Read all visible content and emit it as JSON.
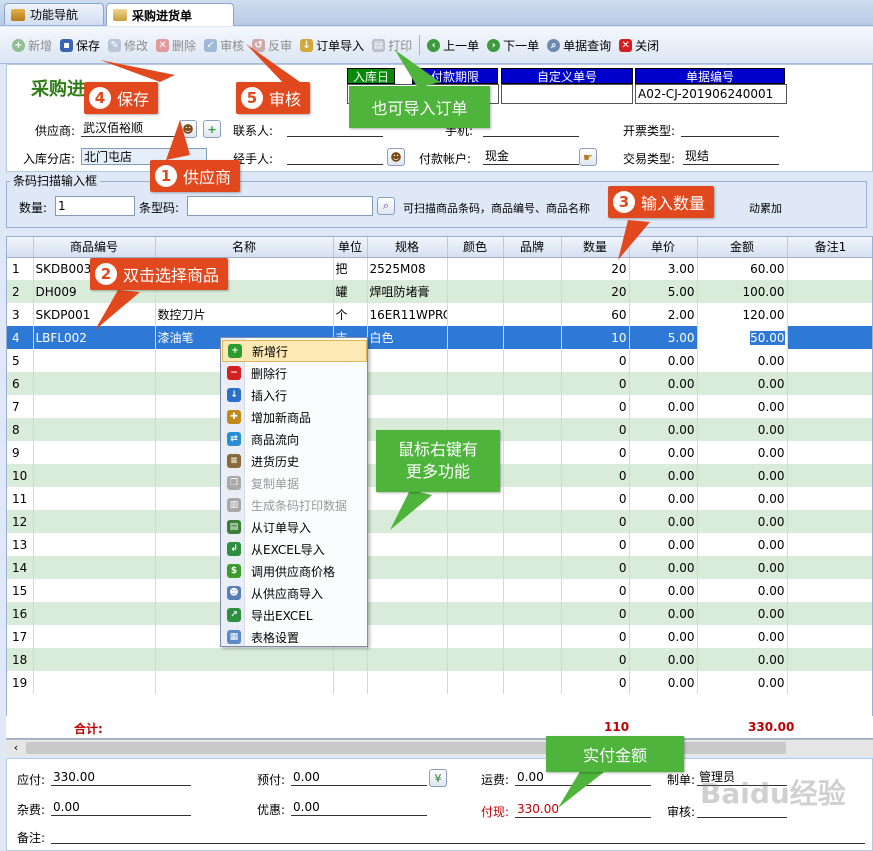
{
  "tabs": [
    {
      "label": "功能导航"
    },
    {
      "label": "采购进货单"
    }
  ],
  "toolbar": {
    "add": "新增",
    "save": "保存",
    "edit": "修改",
    "delete": "删除",
    "audit": "审核",
    "unaudit": "反审",
    "import_order": "订单导入",
    "print": "打印",
    "prev": "上一单",
    "next": "下一单",
    "query": "单据查询",
    "close": "关闭"
  },
  "header": {
    "title": "采购进",
    "col_store": "入库日",
    "col_payterm": "付款期限",
    "col_custom": "自定义单号",
    "col_billno": "单据编号",
    "billno_value": "A02-CJ-201906240001",
    "supplier_label": "供应商:",
    "supplier_value": "武汉佰裕顺",
    "contact_label": "联系人:",
    "phone_label": "手机:",
    "invoice_label": "开票类型:",
    "branch_label": "入库分店:",
    "branch_value": "北门屯店",
    "handler_label": "经手人:",
    "account_label": "付款帐户:",
    "account_value": "现金",
    "trade_label": "交易类型:",
    "trade_value": "现结"
  },
  "barcode": {
    "legend": "条码扫描输入框",
    "qty_label": "数量:",
    "qty_value": "1",
    "code_label": "条型码:",
    "hint": "可扫描商品条码，商品编号、商品名称",
    "hint_tail": "动累加"
  },
  "grid": {
    "columns": [
      "",
      "商品编号",
      "名称",
      "单位",
      "规格",
      "颜色",
      "品牌",
      "数量",
      "单价",
      "金额",
      "备注1"
    ],
    "rows": [
      {
        "no": "1",
        "code": "SKDB003",
        "name": "",
        "unit": "把",
        "spec": "2525M08",
        "qty": "20",
        "price": "3.00",
        "amount": "60.00"
      },
      {
        "no": "2",
        "code": "DH009",
        "name": "",
        "unit": "罐",
        "spec": "焊咀防堵膏",
        "qty": "20",
        "price": "5.00",
        "amount": "100.00"
      },
      {
        "no": "3",
        "code": "SKDP001",
        "name": "数控刀片",
        "unit": "个",
        "spec": "16ER11WPRC",
        "qty": "60",
        "price": "2.00",
        "amount": "120.00"
      },
      {
        "no": "4",
        "code": "LBFL002",
        "name": "漆油笔",
        "unit": "支",
        "spec": "白色",
        "qty": "10",
        "price": "5.00",
        "amount": "50.00"
      },
      {
        "no": "5",
        "code": "",
        "name": "",
        "unit": "",
        "spec": "",
        "qty": "0",
        "price": "0.00",
        "amount": "0.00"
      },
      {
        "no": "6",
        "code": "",
        "name": "",
        "unit": "",
        "spec": "",
        "qty": "0",
        "price": "0.00",
        "amount": "0.00"
      },
      {
        "no": "7",
        "code": "",
        "name": "",
        "unit": "",
        "spec": "",
        "qty": "0",
        "price": "0.00",
        "amount": "0.00"
      },
      {
        "no": "8",
        "code": "",
        "name": "",
        "unit": "",
        "spec": "",
        "qty": "0",
        "price": "0.00",
        "amount": "0.00"
      },
      {
        "no": "9",
        "code": "",
        "name": "",
        "unit": "",
        "spec": "",
        "qty": "0",
        "price": "0.00",
        "amount": "0.00"
      },
      {
        "no": "10",
        "code": "",
        "name": "",
        "unit": "",
        "spec": "",
        "qty": "0",
        "price": "0.00",
        "amount": "0.00"
      },
      {
        "no": "11",
        "code": "",
        "name": "",
        "unit": "",
        "spec": "",
        "qty": "0",
        "price": "0.00",
        "amount": "0.00"
      },
      {
        "no": "12",
        "code": "",
        "name": "",
        "unit": "",
        "spec": "",
        "qty": "0",
        "price": "0.00",
        "amount": "0.00"
      },
      {
        "no": "13",
        "code": "",
        "name": "",
        "unit": "",
        "spec": "",
        "qty": "0",
        "price": "0.00",
        "amount": "0.00"
      },
      {
        "no": "14",
        "code": "",
        "name": "",
        "unit": "",
        "spec": "",
        "qty": "0",
        "price": "0.00",
        "amount": "0.00"
      },
      {
        "no": "15",
        "code": "",
        "name": "",
        "unit": "",
        "spec": "",
        "qty": "0",
        "price": "0.00",
        "amount": "0.00"
      },
      {
        "no": "16",
        "code": "",
        "name": "",
        "unit": "",
        "spec": "",
        "qty": "0",
        "price": "0.00",
        "amount": "0.00"
      },
      {
        "no": "17",
        "code": "",
        "name": "",
        "unit": "",
        "spec": "",
        "qty": "0",
        "price": "0.00",
        "amount": "0.00"
      },
      {
        "no": "18",
        "code": "",
        "name": "",
        "unit": "",
        "spec": "",
        "qty": "0",
        "price": "0.00",
        "amount": "0.00"
      },
      {
        "no": "19",
        "code": "",
        "name": "",
        "unit": "",
        "spec": "",
        "qty": "0",
        "price": "0.00",
        "amount": "0.00"
      }
    ],
    "total_label": "合计:",
    "total_qty": "110",
    "total_amount": "330.00"
  },
  "context_menu": [
    {
      "label": "新增行",
      "icon": "plus-circle-icon",
      "color": "#2e9b2e",
      "glyph": "+",
      "disabled": false
    },
    {
      "label": "删除行",
      "icon": "minus-circle-icon",
      "color": "#d42020",
      "glyph": "−",
      "disabled": false
    },
    {
      "label": "插入行",
      "icon": "insert-row-icon",
      "color": "#2a6fc9",
      "glyph": "↓",
      "disabled": false
    },
    {
      "label": "增加新商品",
      "icon": "new-product-icon",
      "color": "#c08a18",
      "glyph": "✚",
      "disabled": false
    },
    {
      "label": "商品流向",
      "icon": "flow-icon",
      "color": "#2a8fd0",
      "glyph": "⇄",
      "disabled": false
    },
    {
      "label": "进货历史",
      "icon": "history-icon",
      "color": "#8a6a3a",
      "glyph": "≡",
      "disabled": false
    },
    {
      "label": "复制单据",
      "icon": "copy-icon",
      "color": "#a8a8a8",
      "glyph": "❐",
      "disabled": true
    },
    {
      "label": "生成条码打印数据",
      "icon": "barcode-icon",
      "color": "#a8a8a8",
      "glyph": "▥",
      "disabled": true
    },
    {
      "label": "从订单导入",
      "icon": "order-import-icon",
      "color": "#3a7f3a",
      "glyph": "▤",
      "disabled": false
    },
    {
      "label": "从EXCEL导入",
      "icon": "excel-import-icon",
      "color": "#2f8f40",
      "glyph": "↲",
      "disabled": false
    },
    {
      "label": "调用供应商价格",
      "icon": "price-icon",
      "color": "#3b9b2b",
      "glyph": "$",
      "disabled": false
    },
    {
      "label": "从供应商导入",
      "icon": "supplier-import-icon",
      "color": "#5a7fb8",
      "glyph": "☻",
      "disabled": false
    },
    {
      "label": "导出EXCEL",
      "icon": "excel-export-icon",
      "color": "#2f8f40",
      "glyph": "↗",
      "disabled": false
    },
    {
      "label": "表格设置",
      "icon": "table-settings-icon",
      "color": "#5a8ac8",
      "glyph": "▦",
      "disabled": false
    }
  ],
  "footer": {
    "payable_label": "应付:",
    "payable_value": "330.00",
    "prepaid_label": "预付:",
    "prepaid_value": "0.00",
    "freight_label": "运费:",
    "freight_value": "0.00",
    "maker_label": "制单:",
    "maker_value": "管理员",
    "misc_label": "杂费:",
    "misc_value": "0.00",
    "discount_label": "优惠:",
    "discount_value": "0.00",
    "cashpay_label": "付现:",
    "cashpay_value": "330.00",
    "auditor_label": "审核:",
    "remark_label": "备注:"
  },
  "callouts": {
    "c1_num": "1",
    "c1": "供应商",
    "c2_num": "2",
    "c2": "双击选择商品",
    "c3_num": "3",
    "c3": "输入数量",
    "c4_num": "4",
    "c4": "保存",
    "c5_num": "5",
    "c5": "审核",
    "g_import": "也可导入订单",
    "g_rightclick_1": "鼠标右键有",
    "g_rightclick_2": "更多功能",
    "g_actual": "实付金额"
  },
  "watermark": "Baidu经验",
  "colors": {
    "accent": "#e2481d",
    "green_callout": "#4fb43c",
    "selected_row": "#2f79d6",
    "alt_row": "#d9ecd9",
    "total_red": "#c00000"
  }
}
